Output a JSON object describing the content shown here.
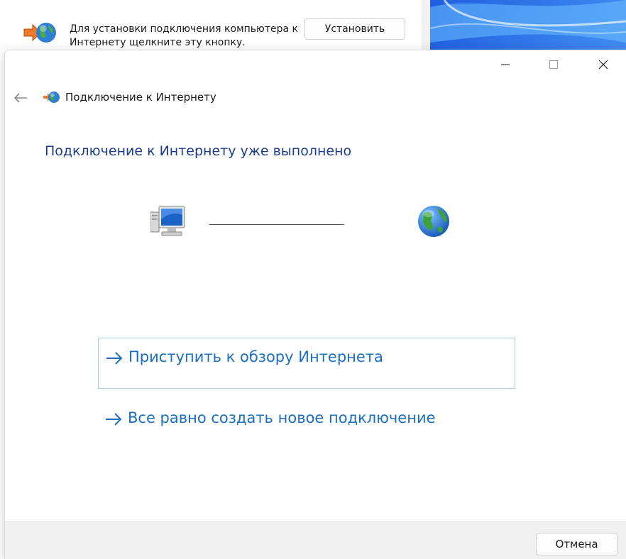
{
  "background_window": {
    "message": "Для установки подключения компьютера к Интернету щелкните эту кнопку.",
    "install_label": "Установить"
  },
  "dialog": {
    "header_title": "Подключение к Интернету",
    "heading": "Подключение к Интернету уже выполнено",
    "tasks": [
      {
        "label": "Приступить к обзору Интернета"
      },
      {
        "label": "Все равно создать новое подключение"
      }
    ],
    "cancel_label": "Отмена"
  },
  "colors": {
    "heading": "#1c3d8c",
    "link": "#1b6fc2",
    "selected_border": "#a9d1e6",
    "wallpaper": "#2a7df4"
  },
  "icons": {
    "back": "arrow-left-icon",
    "header": "network-globe-icon",
    "computer": "computer-icon",
    "globe": "globe-icon",
    "task_arrow": "arrow-right-icon"
  }
}
